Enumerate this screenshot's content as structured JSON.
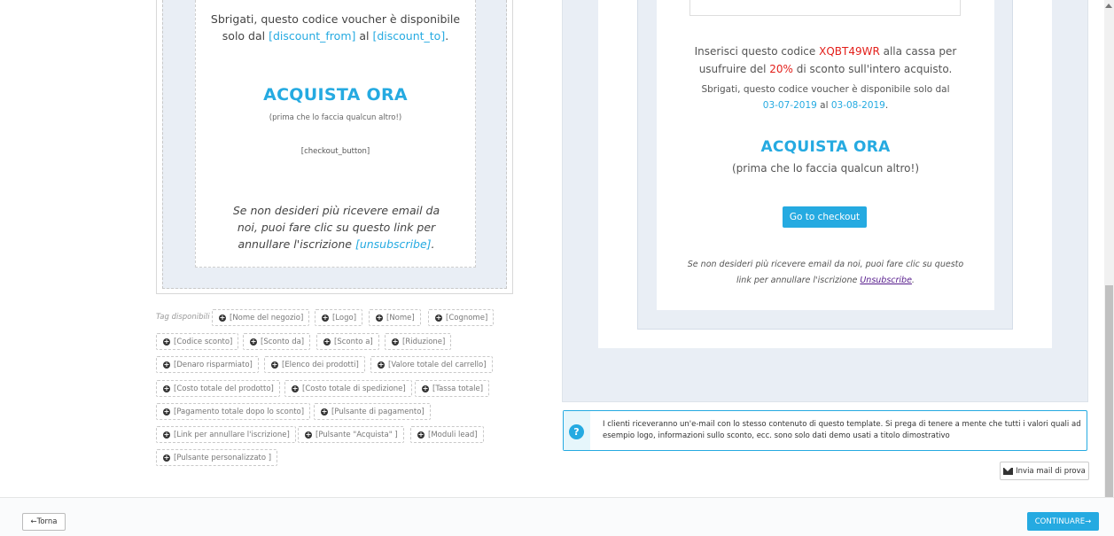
{
  "editor": {
    "hurry_part1": "Sbrigati, questo codice voucher è disponibile",
    "hurry_part2": "solo dal ",
    "discount_from": "[discount_from]",
    "al": " al ",
    "discount_to": "[discount_to]",
    "dot": ".",
    "buy_now": "ACQUISTA ORA",
    "before_someone": "(prima che lo faccia qualcun altro!)",
    "checkout_button": "[checkout_button]",
    "unsub_text": "Se non desideri più ricevere email da noi, puoi fare clic su questo link per annullare l'iscrizione ",
    "unsub_tag": "[unsubscribe]",
    "unsub_dot": "."
  },
  "tags": {
    "label": "Tag disponibili :",
    "items": [
      "[Nome del negozio]",
      "[Logo]",
      "[Nome]",
      "[Cognome]",
      "[Codice sconto]",
      "[Sconto da]",
      "[Sconto a]",
      "[Riduzione]",
      "[Denaro risparmiato]",
      "[Elenco dei prodotti]",
      "[Valore totale del carrello]",
      "[Costo totale del prodotto]",
      "[Costo totale di spedizione]",
      "[Tassa totale]",
      "[Pagamento totale dopo lo sconto]",
      "[Pulsante di pagamento]",
      "[Link per annullare l'iscrizione]",
      "[Pulsante \"Acquista\" ]",
      "[Moduli lead]",
      "[Pulsante personalizzato ]"
    ]
  },
  "preview": {
    "enter_code_pre": "Inserisci questo codice ",
    "code": "XQBT49WR",
    "enter_code_post": " alla cassa per",
    "enjoy_pre": "usufruire del ",
    "percent": "20%",
    "enjoy_post": " di sconto sull'intero acquisto.",
    "hurry": "Sbrigati, questo codice voucher è disponibile solo dal",
    "date_from": "03-07-2019",
    "al": " al ",
    "date_to": "03-08-2019",
    "dot": ".",
    "buy_now": "ACQUISTA ORA",
    "before_someone": "(prima che lo faccia qualcun altro!)",
    "checkout_label": "Go to checkout",
    "unsub_text": "Se non desideri più ricevere email da noi, puoi fare clic su questo link per annullare l'iscrizione ",
    "unsub_link": "Unsubscribe",
    "unsub_dot": "."
  },
  "info": {
    "text": "I clienti riceveranno un'e-mail con lo stesso contenuto di questo template. Si prega di tenere a mente che tutti i valori quali ad esempio logo, informazioni sullo sconto, ecc. sono solo dati demo usati a titolo dimostrativo",
    "icon": "question-circle-icon"
  },
  "test_mail": {
    "label": "Invia mail di prova",
    "icon": "envelope-icon"
  },
  "footer": {
    "back_label": "Torna",
    "continue_label": "CONTINUARE"
  },
  "colors": {
    "accent": "#25aae1",
    "code_red": "#e3201b",
    "panel_bg": "#e9eef5"
  }
}
